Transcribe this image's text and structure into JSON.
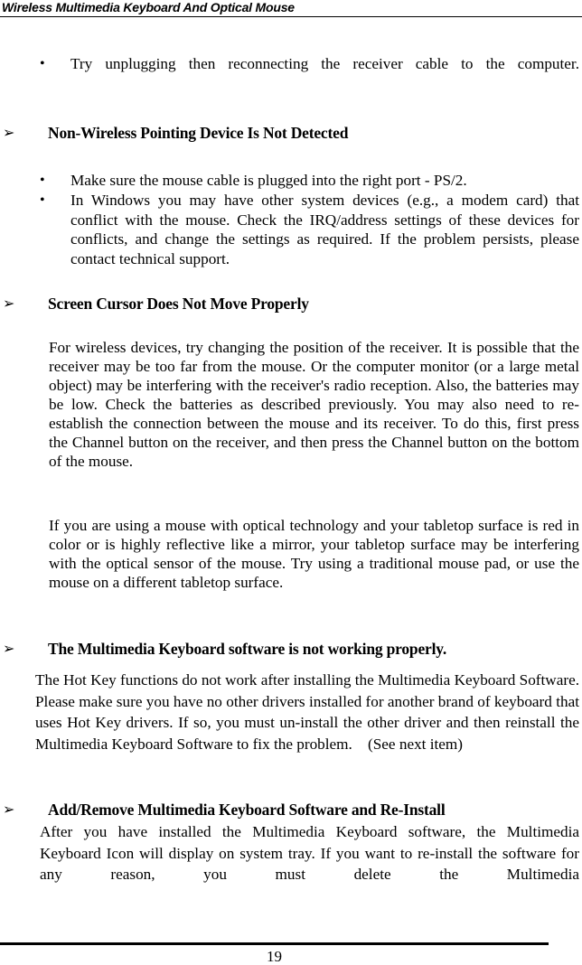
{
  "header": {
    "title": "Wireless Multimedia Keyboard And Optical Mouse"
  },
  "icons": {
    "bullet": "•",
    "arrow": "➢"
  },
  "sections": [
    {
      "bullets": [
        "Try unplugging then reconnecting the receiver cable to the computer."
      ]
    },
    {
      "heading": "Non-Wireless Pointing Device Is Not Detected",
      "bullets": [
        "Make sure the mouse cable is plugged into the right port - PS/2.",
        "In Windows you may have other system devices (e.g., a modem card) that conflict with the mouse. Check the IRQ/address settings of these devices for conflicts, and change the settings as required. If the problem persists, please contact technical support."
      ]
    },
    {
      "heading": "Screen Cursor Does Not Move Properly",
      "paragraphs": [
        "For wireless devices, try changing the position of the receiver. It is possible that the receiver may be too far from the mouse. Or the computer monitor (or a large metal object) may be interfering with the receiver's radio reception. Also, the batteries may be low. Check the batteries as described previously. You may also need to re-establish the connection between the mouse and its receiver. To do this, first press the Channel button on the receiver, and then press the Channel button on the bottom of the mouse.",
        "If you are using a mouse with optical technology and your tabletop surface is red in color or is highly reflective like a mirror, your tabletop surface may be interfering with the optical sensor of the mouse. Try using a traditional mouse pad, or use the mouse on a different tabletop surface."
      ]
    },
    {
      "heading": "The Multimedia Keyboard software is not working properly.",
      "paragraphs": [
        "The Hot Key functions do not work after installing the Multimedia Keyboard Software. Please make sure you have no other drivers installed for another brand of keyboard that uses Hot Key drivers. If so, you must un-install the other driver and then reinstall the Multimedia Keyboard Software to fix the problem.    (See next item)"
      ]
    },
    {
      "heading": "Add/Remove Multimedia Keyboard Software and Re-Install",
      "paragraphs": [
        "After you have installed the Multimedia Keyboard software, the Multimedia Keyboard Icon will display on system tray. If you want to re-install the software for any reason, you must delete the Multimedia"
      ]
    }
  ],
  "footer": {
    "page_number": "19"
  }
}
